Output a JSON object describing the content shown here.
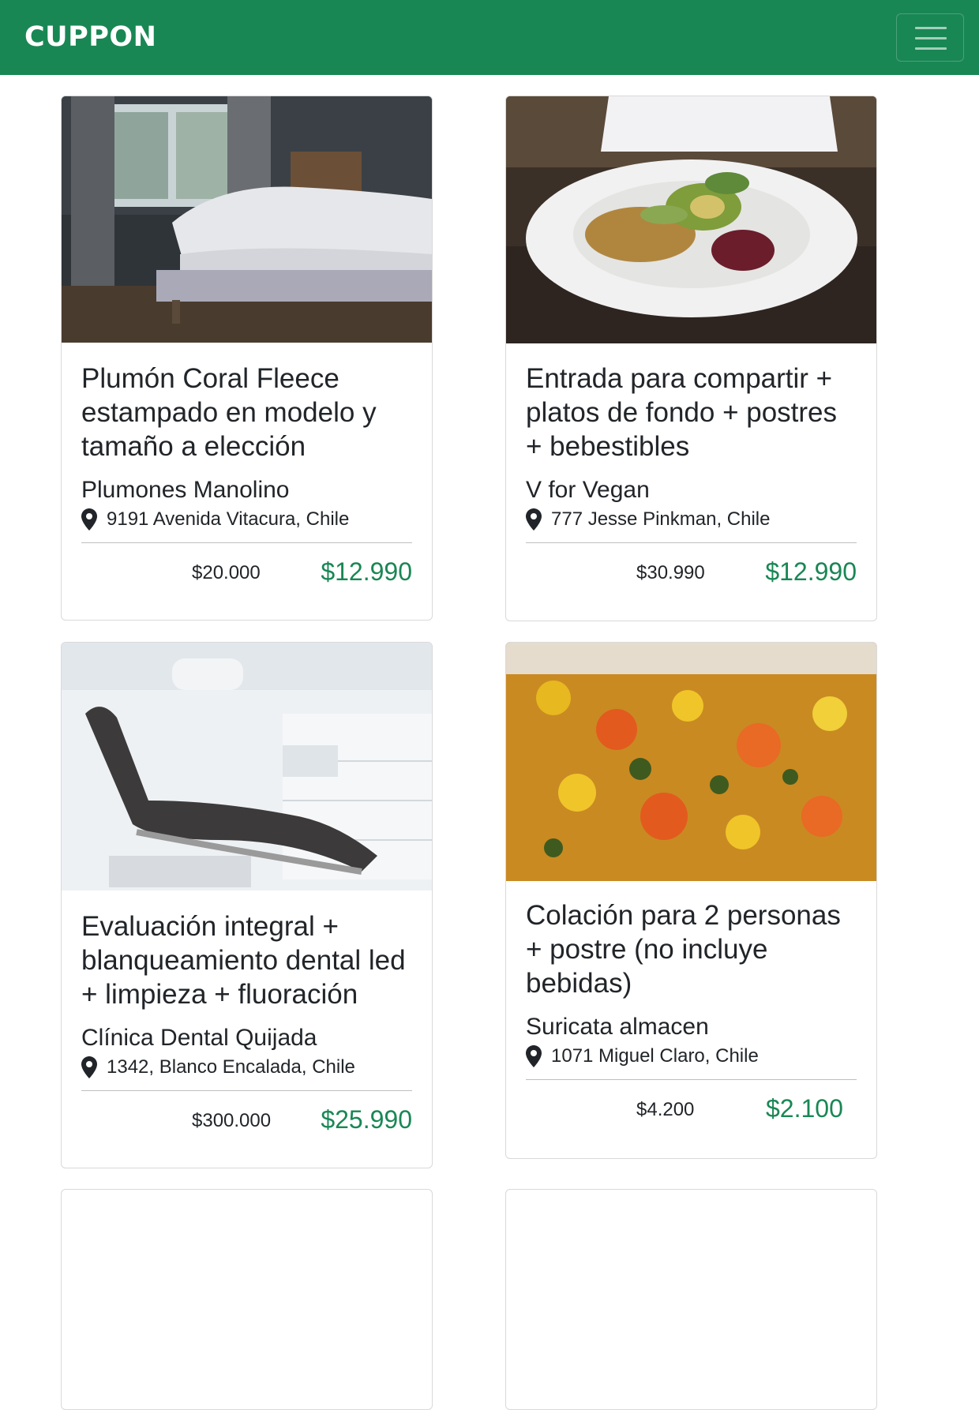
{
  "navbar": {
    "brand": "CUPPON",
    "bg_color": "#198754",
    "toggler_icon": "hamburger-icon"
  },
  "colors": {
    "price_accent": "#198754",
    "text": "#212529"
  },
  "deals": [
    {
      "image_icon": "bedroom-photo",
      "title": "Plumón Coral Fleece estampado en modelo y tamaño a elección",
      "merchant": "Plumones Manolino",
      "location_icon": "map-pin-icon",
      "address": "9191 Avenida Vitacura, Chile",
      "original_price": "$20.000",
      "price": "$12.990"
    },
    {
      "image_icon": "vegan-salad-photo",
      "title": "Entrada para compartir + platos de fondo + postres + bebestibles",
      "merchant": "V for Vegan",
      "location_icon": "map-pin-icon",
      "address": "777 Jesse Pinkman, Chile",
      "original_price": "$30.990",
      "price": "$12.990"
    },
    {
      "image_icon": "dental-clinic-photo",
      "title": "Evaluación integral + blanqueamiento dental led + limpieza + fluoración",
      "merchant": "Clínica Dental Quijada",
      "location_icon": "map-pin-icon",
      "address": "1342, Blanco Encalada, Chile",
      "original_price": "$300.000",
      "price": "$25.990"
    },
    {
      "image_icon": "vegetable-stew-photo",
      "title": "Colación para 2 personas + postre (no incluye bebidas)",
      "merchant": "Suricata almacen",
      "location_icon": "map-pin-icon",
      "address": "1071 Miguel Claro, Chile",
      "original_price": "$4.200",
      "price": "$2.100"
    }
  ]
}
